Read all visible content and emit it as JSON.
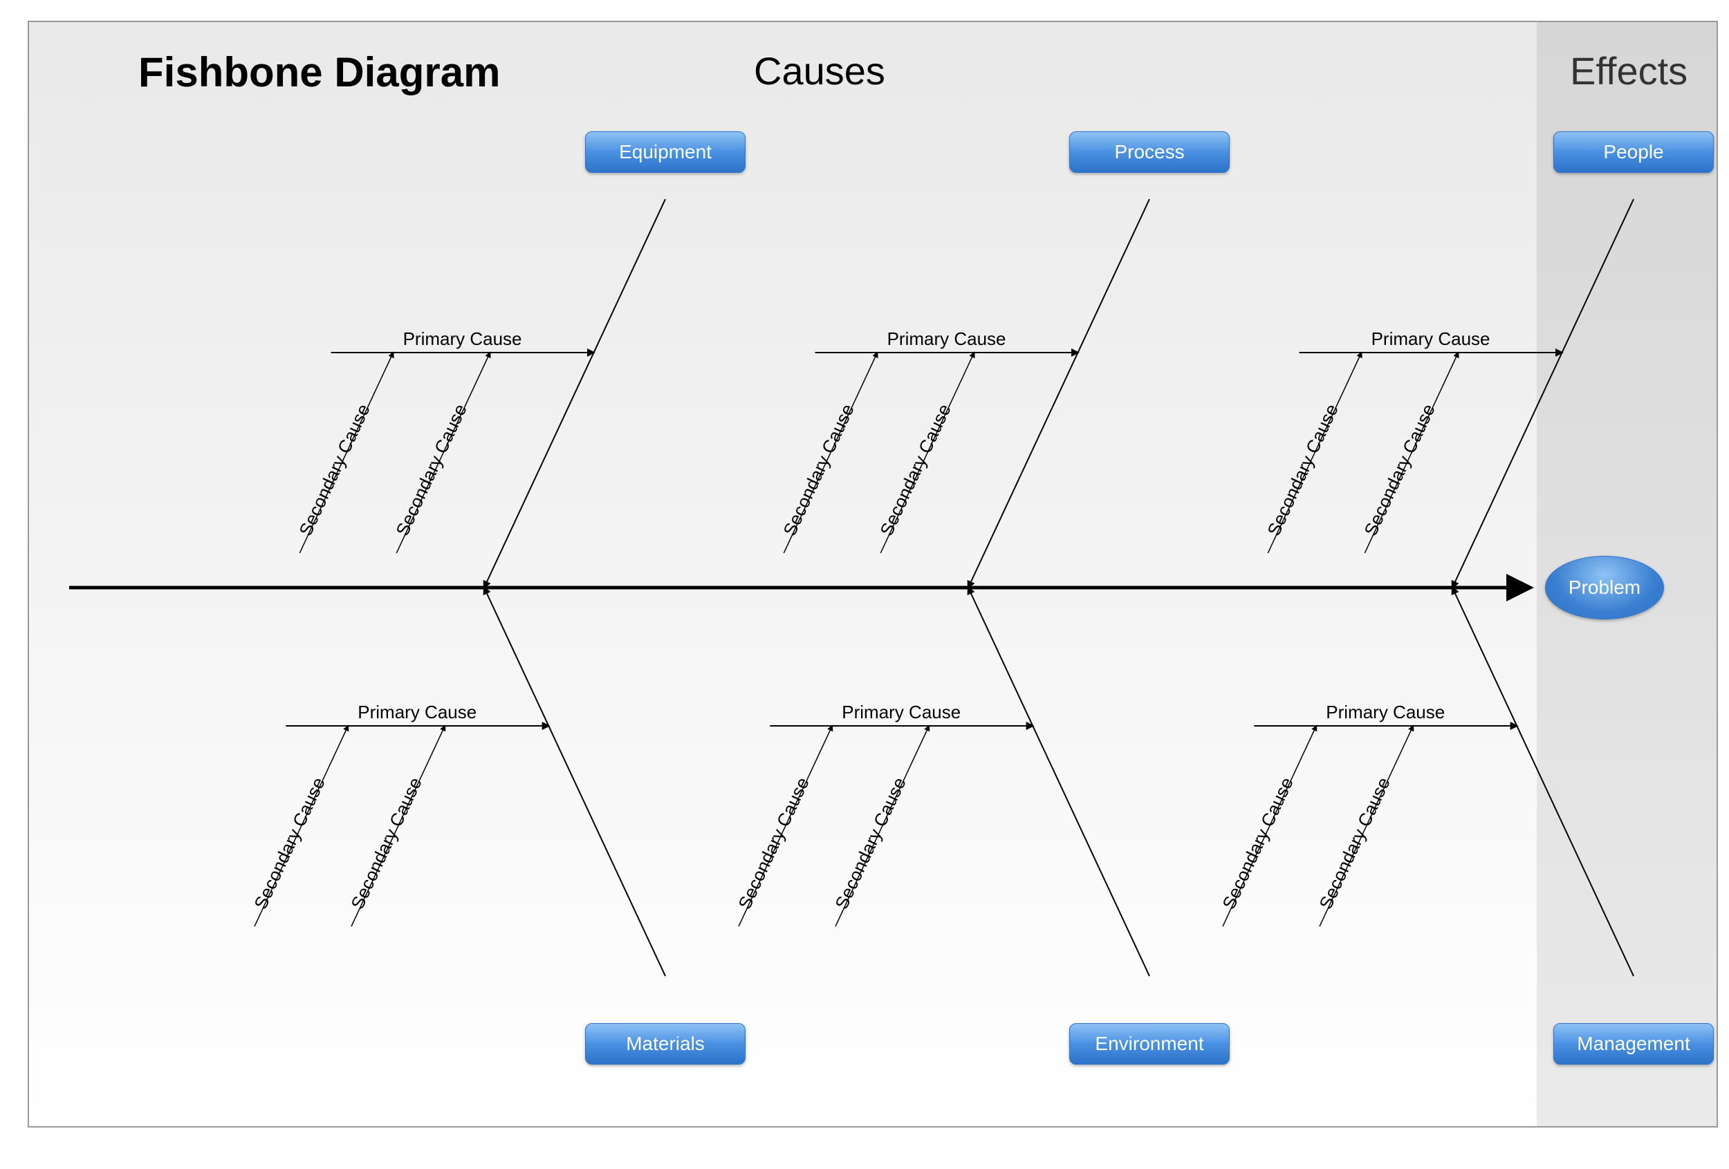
{
  "title": "Fishbone Diagram",
  "header_causes": "Causes",
  "header_effects": "Effects",
  "problem_label": "Problem",
  "categories_top": [
    "Equipment",
    "Process",
    "People"
  ],
  "categories_bottom": [
    "Materials",
    "Environment",
    "Management"
  ],
  "primary_label": "Primary Cause",
  "secondary_label": "Secondary Cause",
  "chart_data": {
    "type": "fishbone",
    "effect": "Problem",
    "causes": [
      {
        "category": "Equipment",
        "side": "top",
        "primary": [
          "Primary Cause"
        ],
        "secondary": [
          "Secondary Cause",
          "Secondary Cause"
        ]
      },
      {
        "category": "Process",
        "side": "top",
        "primary": [
          "Primary Cause"
        ],
        "secondary": [
          "Secondary Cause",
          "Secondary Cause"
        ]
      },
      {
        "category": "People",
        "side": "top",
        "primary": [
          "Primary Cause"
        ],
        "secondary": [
          "Secondary Cause",
          "Secondary Cause"
        ]
      },
      {
        "category": "Materials",
        "side": "bottom",
        "primary": [
          "Primary Cause"
        ],
        "secondary": [
          "Secondary Cause",
          "Secondary Cause"
        ]
      },
      {
        "category": "Environment",
        "side": "bottom",
        "primary": [
          "Primary Cause"
        ],
        "secondary": [
          "Secondary Cause",
          "Secondary Cause"
        ]
      },
      {
        "category": "Management",
        "side": "bottom",
        "primary": [
          "Primary Cause"
        ],
        "secondary": [
          "Secondary Cause",
          "Secondary Cause"
        ]
      }
    ]
  }
}
